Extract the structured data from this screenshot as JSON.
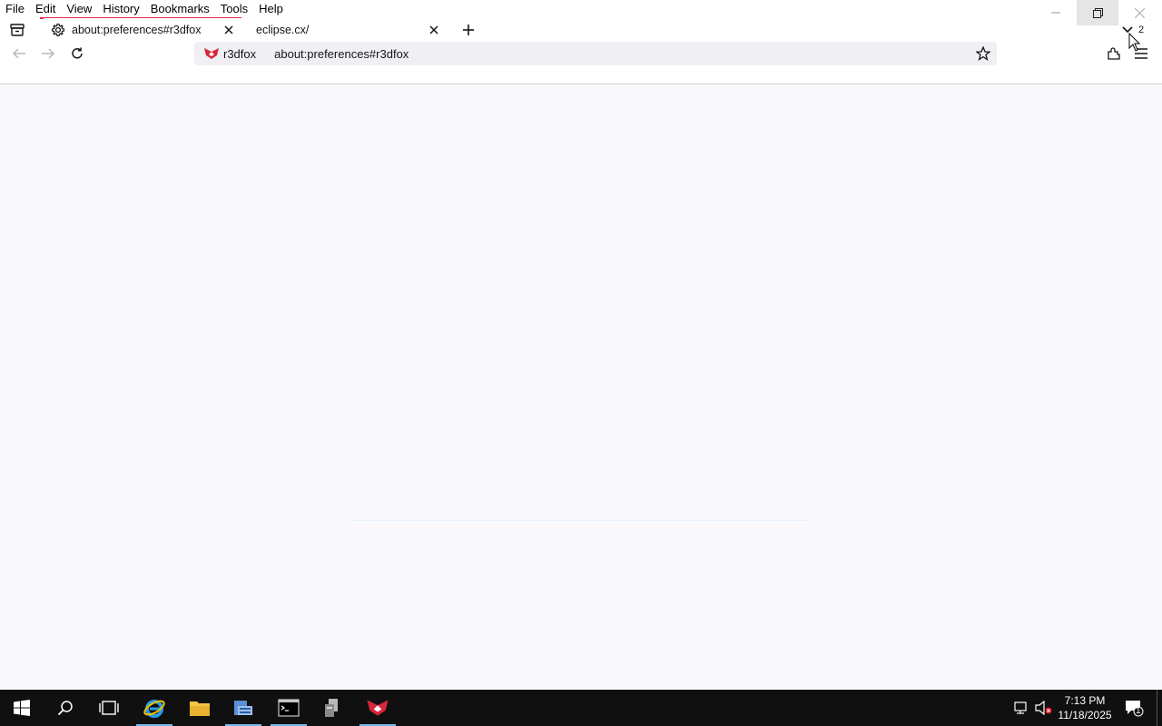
{
  "menubar": {
    "items": [
      "File",
      "Edit",
      "View",
      "History",
      "Bookmarks",
      "Tools",
      "Help"
    ]
  },
  "tabs": [
    {
      "title": "about:preferences#r3dfox",
      "icon": "gear-icon",
      "active": true
    },
    {
      "title": "eclipse.cx/",
      "icon": "",
      "active": false
    }
  ],
  "tabs_count": "2",
  "urlbar": {
    "identity_label": "r3dfox",
    "url": "about:preferences#r3dfox"
  },
  "taskbar": {
    "apps": [
      "start-icon",
      "search-icon",
      "task-view-icon",
      "internet-explorer-icon",
      "file-explorer-icon",
      "server-manager-icon",
      "command-prompt-icon",
      "network-app-icon",
      "r3dfox-icon"
    ],
    "time": "7:13 PM",
    "date": "11/18/2025",
    "notification_count": "1"
  },
  "colors": {
    "accent": "#e22850",
    "taskbar": "#101010",
    "content_bg": "#f9f9fb"
  }
}
